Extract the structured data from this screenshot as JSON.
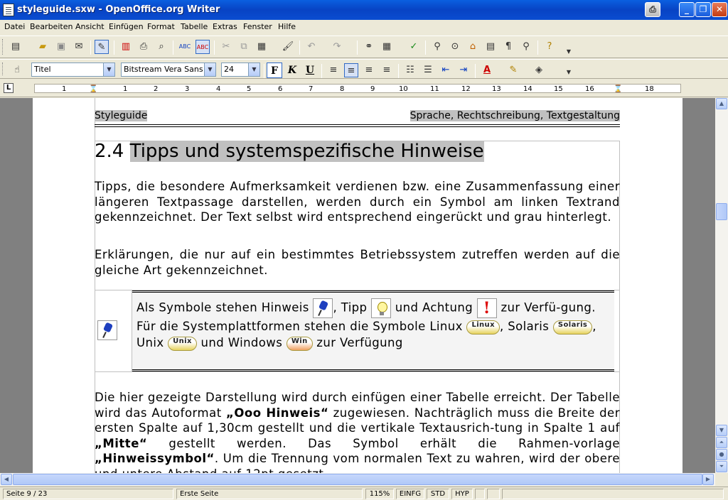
{
  "window": {
    "title": "styleguide.sxw - OpenOffice.org Writer",
    "minimize_label": "_",
    "restore_label": "❐",
    "close_label": "✕"
  },
  "menu": {
    "items": [
      "Datei",
      "Bearbeiten",
      "Ansicht",
      "Einfügen",
      "Format",
      "Tabelle",
      "Extras",
      "Fenster",
      "Hilfe"
    ]
  },
  "format_bar": {
    "style": "Titel",
    "font": "Bitstream Vera Sans",
    "size": "24",
    "bold": "F",
    "italic": "K",
    "underline": "U"
  },
  "ruler": {
    "labels": [
      "1",
      "1",
      "2",
      "3",
      "4",
      "5",
      "6",
      "7",
      "8",
      "9",
      "10",
      "11",
      "12",
      "13",
      "14",
      "15",
      "16",
      "17",
      "18"
    ]
  },
  "document": {
    "header_left": "Styleguide",
    "header_right": "Sprache, Rechtschreibung, Textgestaltung",
    "heading_number": "2.4 ",
    "heading_text": "Tipps und systemspezifische Hinweise",
    "para1": "Tipps, die besondere Aufmerksamkeit verdienen bzw. eine Zusammenfassung einer längeren Textpassage darstellen, werden durch ein Symbol am linken Textrand gekennzeichnet. Der Text selbst wird entsprechend eingerückt und grau hinterlegt.",
    "para2": "Erklärungen, die nur auf ein bestimmtes Betriebssystem zutreffen werden auf die gleiche Art gekennzeichnet.",
    "note": {
      "t1": "Als Symbole stehen Hinweis ",
      "t2": ", Tipp ",
      "t3": " und Achtung ",
      "t4": " zur Verfü-gung.",
      "t5": "Für die Systemplattformen stehen die Symbole Linux ",
      "t6": ", Solaris ",
      "t7": ", Unix ",
      "t8": " und Windows ",
      "t9": " zur Verfügung",
      "badge_linux": "Linux",
      "badge_solaris": "Solaris",
      "badge_unix": "Unix",
      "badge_win": "Win"
    },
    "para3": {
      "a": "Die hier gezeigte Darstellung wird durch einfügen einer Tabelle erreicht. Der Tabelle wird das Autoformat ",
      "b": "„Ooo Hinweis“",
      "c": " zugewiesen. Nachträglich muss die Breite der ersten Spalte auf 1,30cm gestellt und die vertikale Textausrich-tung in Spalte 1 auf ",
      "d": "„Mitte“",
      "e": " gestellt werden. Das Symbol erhält die Rahmen-vorlage ",
      "f": "„Hinweissymbol“",
      "g": ". Um die Trennung vom normalen Text zu wahren, wird der obere und untere Abstand auf 12pt gesetzt."
    }
  },
  "statusbar": {
    "page": "Seite 9 / 23",
    "page_style": "Erste Seite",
    "zoom": "115%",
    "insert_mode": "EINFG",
    "selection_mode": "STD",
    "hyperlink_mode": "HYP"
  }
}
